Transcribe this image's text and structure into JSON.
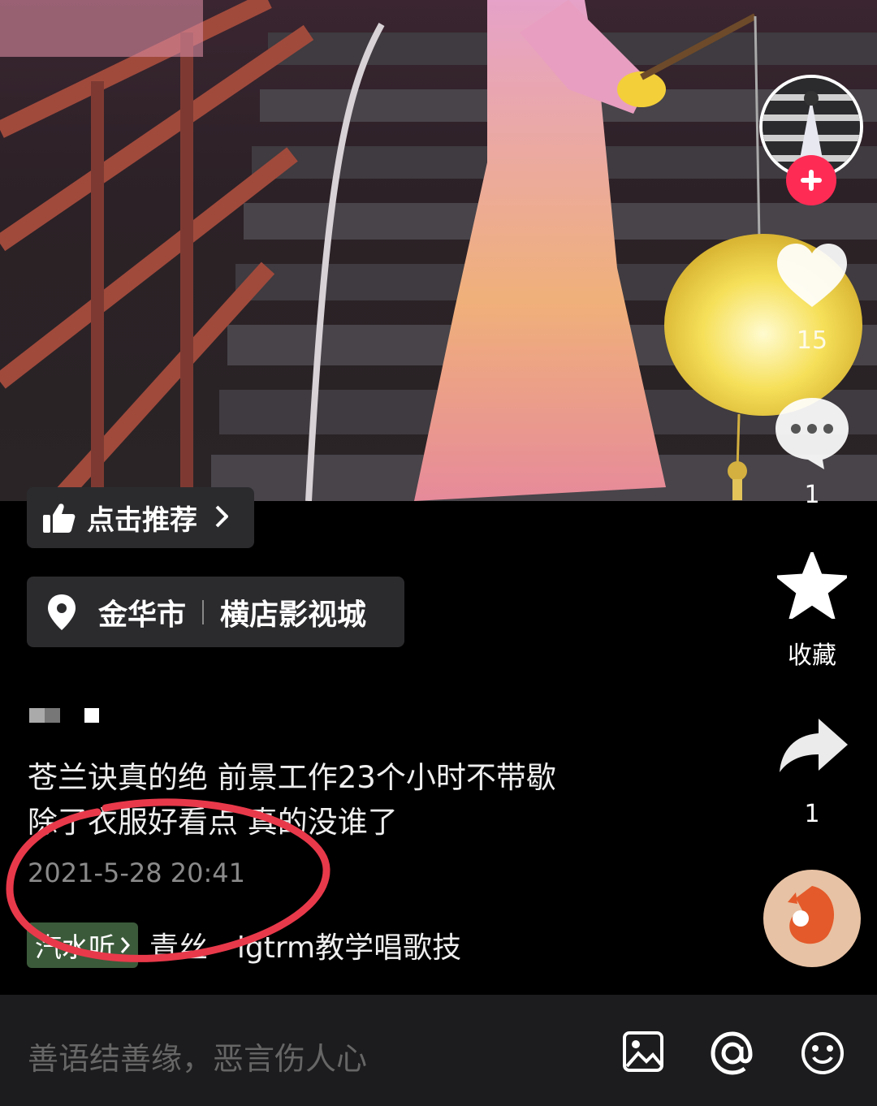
{
  "video": {
    "recommend_label": "点击推荐",
    "location": {
      "city": "金华市",
      "place": "横店影视城"
    },
    "caption_lines": [
      "苍兰诀真的绝 前景工作23个小时不带歇",
      "除了衣服好看点 真的没谁了"
    ],
    "timestamp": "2021-5-28 20:41",
    "music_tag": "汽水听",
    "music_song": "青丝 - lgtrm教学唱歌技"
  },
  "rail": {
    "likes": "15",
    "comments": "1",
    "favorite_label": "收藏",
    "shares": "1"
  },
  "input": {
    "placeholder": "善语结善缘，恶言伤人心"
  },
  "colors": {
    "follow": "#fe2c55",
    "annotation": "#e8394a",
    "chip_bg": "#2b2b2e"
  },
  "icons": [
    "thumbs-up-icon",
    "chevron-right-icon",
    "location-pin-icon",
    "heart-icon",
    "comment-icon",
    "star-icon",
    "share-icon",
    "image-icon",
    "at-icon",
    "emoji-icon",
    "plus-icon"
  ]
}
